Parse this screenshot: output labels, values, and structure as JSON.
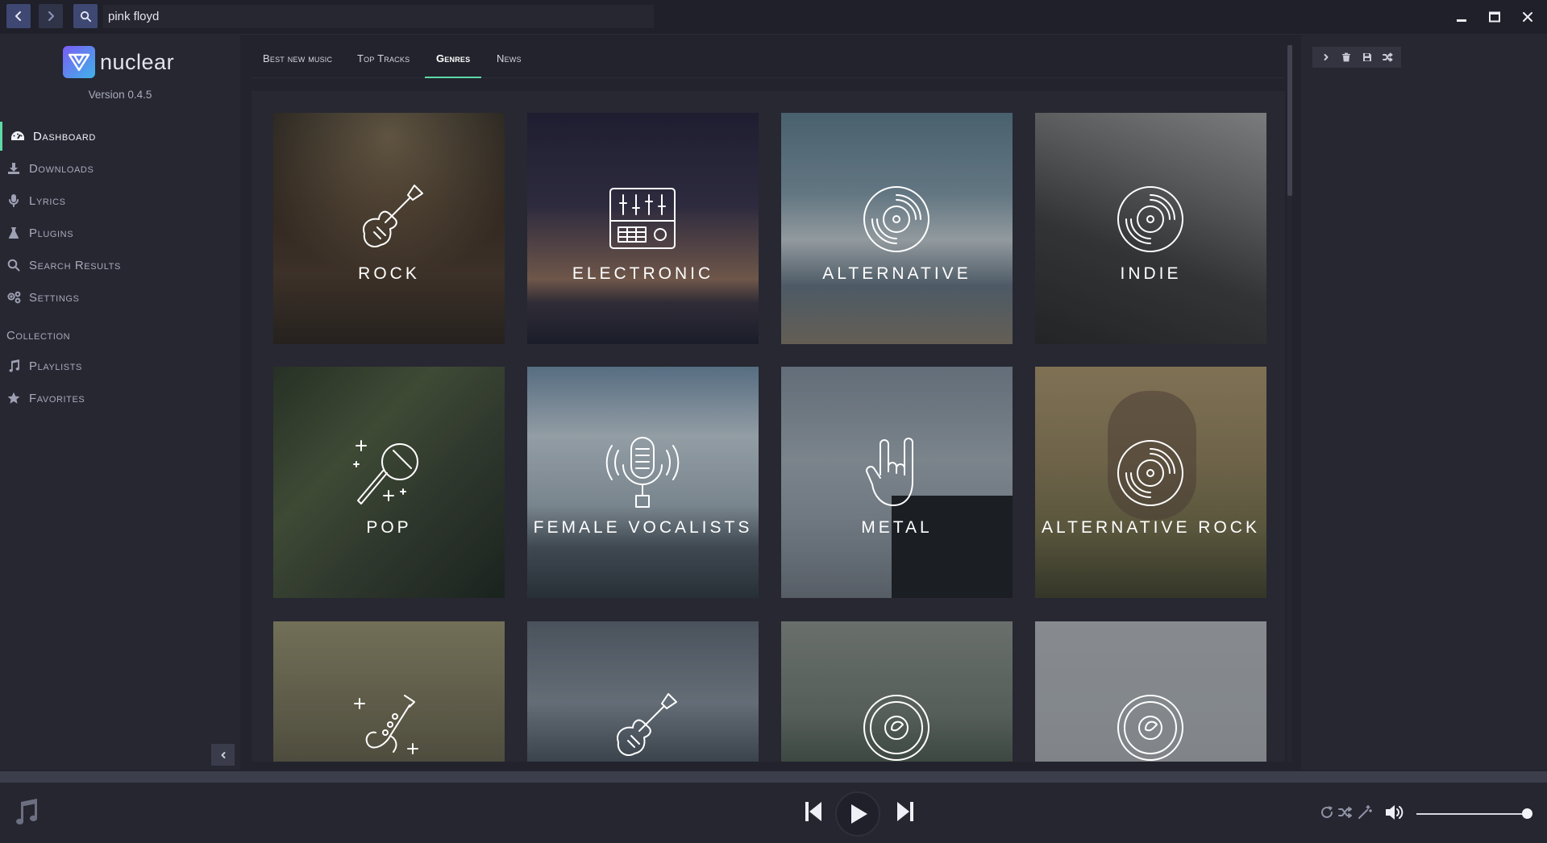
{
  "topbar": {
    "search_value": "pink floyd",
    "search_placeholder": "Search..."
  },
  "sidebar": {
    "app_name": "nuclear",
    "version": "Version 0.4.5",
    "items": [
      {
        "label": "Dashboard",
        "icon": "dashboard-icon",
        "active": true
      },
      {
        "label": "Downloads",
        "icon": "download-icon"
      },
      {
        "label": "Lyrics",
        "icon": "microphone-icon"
      },
      {
        "label": "Plugins",
        "icon": "flask-icon"
      },
      {
        "label": "Search Results",
        "icon": "search-icon"
      },
      {
        "label": "Settings",
        "icon": "cogs-icon"
      }
    ],
    "collection_label": "Collection",
    "collection_items": [
      {
        "label": "Playlists",
        "icon": "music-icon"
      },
      {
        "label": "Favorites",
        "icon": "star-icon"
      }
    ]
  },
  "tabs": [
    {
      "label": "Best new music"
    },
    {
      "label": "Top Tracks"
    },
    {
      "label": "Genres",
      "active": true
    },
    {
      "label": "News"
    }
  ],
  "genres": [
    {
      "label": "Rock",
      "icon": "electric-guitar-icon"
    },
    {
      "label": "Electronic",
      "icon": "mixer-icon"
    },
    {
      "label": "Alternative",
      "icon": "vinyl-icon"
    },
    {
      "label": "Indie",
      "icon": "vinyl-icon"
    },
    {
      "label": "Pop",
      "icon": "microphone-stars-icon"
    },
    {
      "label": "Female Vocalists",
      "icon": "studio-mic-icon"
    },
    {
      "label": "Metal",
      "icon": "rock-hand-icon"
    },
    {
      "label": "Alternative Rock",
      "icon": "vinyl-icon"
    },
    {
      "label": "",
      "icon": "saxophone-icon"
    },
    {
      "label": "",
      "icon": "electric-guitar-icon"
    },
    {
      "label": "",
      "icon": "record-icon"
    },
    {
      "label": "",
      "icon": "record-icon"
    }
  ],
  "queue": {
    "toolbar": [
      "chevron-right-icon",
      "trash-icon",
      "save-icon",
      "shuffle-icon"
    ]
  },
  "player": {
    "volume": 0.97
  }
}
